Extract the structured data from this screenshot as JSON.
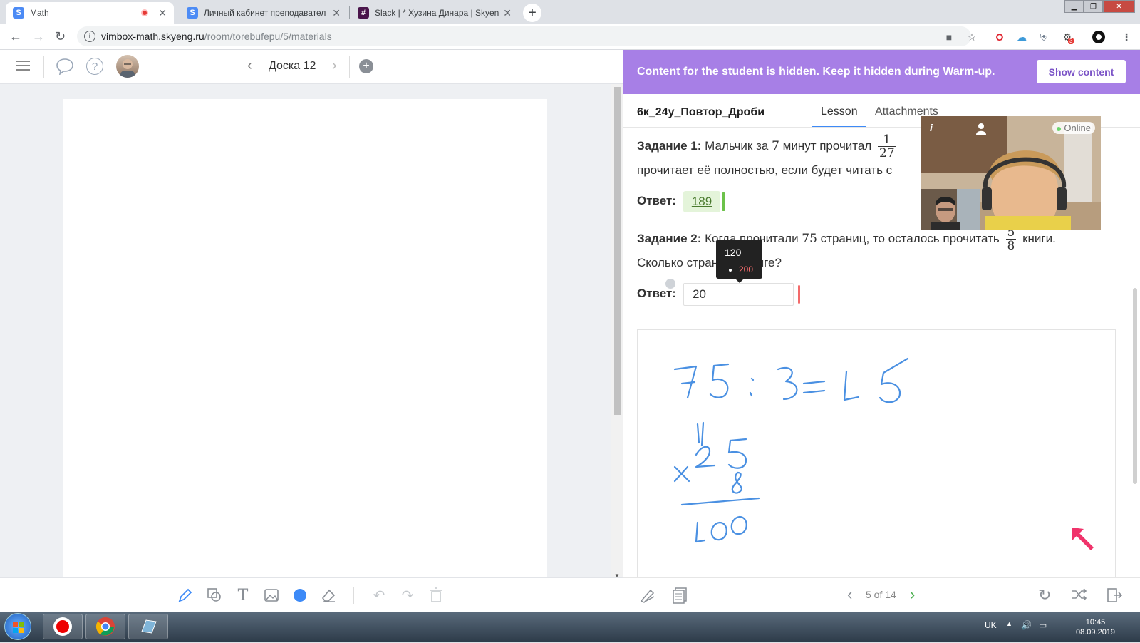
{
  "browser": {
    "tabs": [
      {
        "title": "Math",
        "favicon": "S"
      },
      {
        "title": "Личный кабинет преподавател",
        "favicon": "S"
      },
      {
        "title": "Slack | * Хузина Динара | Skyeng",
        "favicon": "#"
      }
    ],
    "url_host": "vimbox-math.skyeng.ru",
    "url_path": "/room/torebufepu/5/materials",
    "extension_badge": "3"
  },
  "left": {
    "board_title": "Доска 12"
  },
  "right": {
    "banner_text": "Content for the student is hidden. Keep it hidden during Warm-up.",
    "show_button": "Show content",
    "lesson_title": "6к_24у_Повтор_Дроби",
    "tab_lesson": "Lesson",
    "tab_attachments": "Attachments",
    "task1": {
      "label": "Задание 1:",
      "text_before": "Мальчик за",
      "num": "7",
      "text_after": "минут прочитал",
      "frac_num": "1",
      "frac_den": "27",
      "line2": "прочитает её полностью, если будет читать с",
      "answer_label": "Ответ:",
      "answer": "189"
    },
    "task2": {
      "label": "Задание 2:",
      "text_before": "Когда прочитали",
      "num": "75",
      "text_after": "страниц, то осталось прочитать",
      "frac_num": "5",
      "frac_den": "8",
      "tail": "книги.",
      "line2": "Сколько страниц в книге?",
      "answer_label": "Ответ:",
      "answer": "20"
    },
    "tooltip": {
      "top": "120",
      "bottom": "200"
    },
    "pager": "5 of 14"
  },
  "video": {
    "status": "Online"
  },
  "taskbar": {
    "lang": "UK",
    "time": "10:45",
    "date": "08.09.2019"
  },
  "colors": {
    "banner": "#a77fe6",
    "accent": "#3d8af7",
    "ok": "#6cc24a",
    "error": "#f36a6a",
    "ink": "#4a90e2"
  }
}
